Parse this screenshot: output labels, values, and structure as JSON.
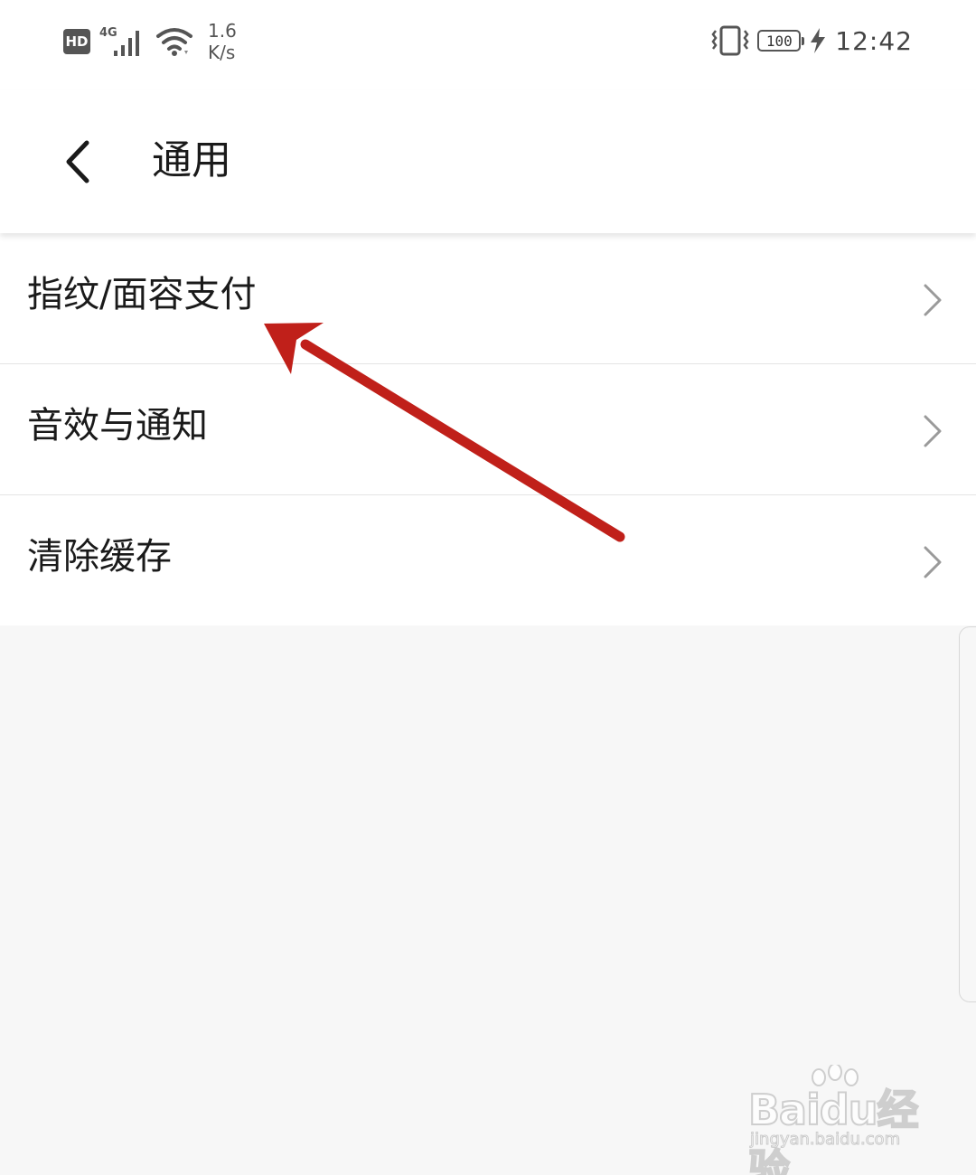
{
  "status_bar": {
    "hd_label": "HD",
    "network_type": "4G",
    "net_speed_value": "1.6",
    "net_speed_unit": "K/s",
    "battery_level": "100",
    "time": "12:42"
  },
  "header": {
    "title": "通用"
  },
  "menu": {
    "items": [
      {
        "label": "指纹/面容支付"
      },
      {
        "label": "音效与通知"
      },
      {
        "label": "清除缓存"
      }
    ]
  },
  "watermark": {
    "brand": "Baidu经验",
    "sub": "jingyan.baidu.com"
  },
  "colors": {
    "annotation_arrow": "#c0201a",
    "text_primary": "#1a1a1a",
    "chevron": "#9a9a9a",
    "background": "#f7f7f7"
  }
}
